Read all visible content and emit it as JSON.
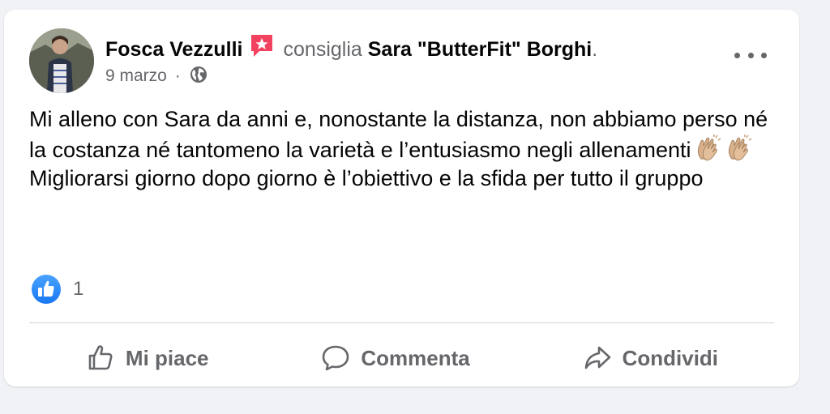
{
  "post": {
    "author": "Fosca Vezzulli",
    "recommend_text": "consiglia",
    "page_name": "Sara \"ButterFit\" Borghi",
    "trailing_period": ".",
    "date": "9 marzo",
    "separator": "·",
    "privacy_icon": "globe-icon",
    "text_lines": [
      "Mi alleno con Sara da anni e, nonostante la distanza, non abbiamo perso né la costanza né tantomeno la varietà e l’entusiasmo negli allenamenti",
      "Migliorarsi giorno dopo giorno è l’obiettivo e la sfida per tutto il gruppo"
    ],
    "emojis": [
      "clapping-hands-emoji",
      "clapping-hands-emoji"
    ]
  },
  "reactions": {
    "icon": "like-thumb-icon",
    "count": "1"
  },
  "actions": {
    "like_label": "Mi piace",
    "comment_label": "Commenta",
    "share_label": "Condividi"
  },
  "colors": {
    "background": "#f0f2f5",
    "card": "#ffffff",
    "primary_text": "#050505",
    "secondary_text": "#65676b",
    "like_blue": "#1877f2",
    "recommend_red": "#f3425f",
    "divider": "#ced0d4"
  }
}
